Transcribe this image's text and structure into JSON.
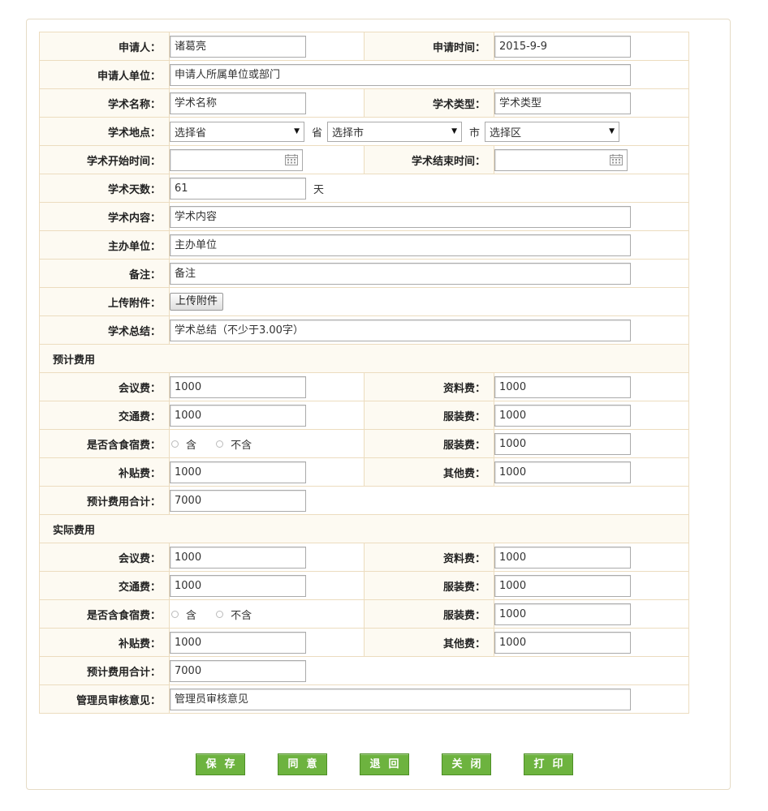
{
  "applicant": {
    "label": "申请人：",
    "value": "诸葛亮"
  },
  "apply_time": {
    "label": "申请时间：",
    "value": "2015-9-9"
  },
  "applicant_unit": {
    "label": "申请人单位：",
    "value": "申请人所属单位或部门"
  },
  "academic_name": {
    "label": "学术名称：",
    "value": "学术名称"
  },
  "academic_type": {
    "label": "学术类型：",
    "value": "学术类型"
  },
  "location": {
    "label": "学术地点：",
    "province": "选择省",
    "province_unit": "省",
    "city": "选择市",
    "city_unit": "市",
    "district": "选择区"
  },
  "start_time": {
    "label": "学术开始时间：",
    "value": ""
  },
  "end_time": {
    "label": "学术结束时间：",
    "value": ""
  },
  "days": {
    "label": "学术天数：",
    "value": "61",
    "unit": "天"
  },
  "content": {
    "label": "学术内容：",
    "value": "学术内容"
  },
  "organizer": {
    "label": "主办单位：",
    "value": "主办单位"
  },
  "remark": {
    "label": "备注：",
    "value": "备注"
  },
  "attachment": {
    "label": "上传附件：",
    "button": "上传附件"
  },
  "summary": {
    "label": "学术总结：",
    "value": "学术总结（不少于3.00字）"
  },
  "estimated": {
    "title": "预计费用",
    "meeting": {
      "label": "会议费：",
      "value": "1000"
    },
    "material": {
      "label": "资料费：",
      "value": "1000"
    },
    "transport": {
      "label": "交通费：",
      "value": "1000"
    },
    "clothing": {
      "label": "服装费：",
      "value": "1000"
    },
    "lodging": {
      "label": "是否含食宿费：",
      "opt_yes": "含",
      "opt_no": "不含"
    },
    "clothing2": {
      "label": "服装费：",
      "value": "1000"
    },
    "subsidy": {
      "label": "补贴费：",
      "value": "1000"
    },
    "other": {
      "label": "其他费：",
      "value": "1000"
    },
    "total": {
      "label": "预计费用合计：",
      "value": "7000"
    }
  },
  "actual": {
    "title": "实际费用",
    "meeting": {
      "label": "会议费：",
      "value": "1000"
    },
    "material": {
      "label": "资料费：",
      "value": "1000"
    },
    "transport": {
      "label": "交通费：",
      "value": "1000"
    },
    "clothing": {
      "label": "服装费：",
      "value": "1000"
    },
    "lodging": {
      "label": "是否含食宿费：",
      "opt_yes": "含",
      "opt_no": "不含"
    },
    "clothing2": {
      "label": "服装费：",
      "value": "1000"
    },
    "subsidy": {
      "label": "补贴费：",
      "value": "1000"
    },
    "other": {
      "label": "其他费：",
      "value": "1000"
    },
    "total": {
      "label": "预计费用合计：",
      "value": "7000"
    }
  },
  "admin_review": {
    "label": "管理员审核意见：",
    "value": "管理员审核意见"
  },
  "actions": {
    "save": "保存",
    "agree": "同意",
    "reject": "退回",
    "close": "关闭",
    "print": "打印"
  },
  "colors": {
    "button_green": "#6db33f",
    "label_bg": "#fdfaf2",
    "border": "#ecdcbf"
  }
}
